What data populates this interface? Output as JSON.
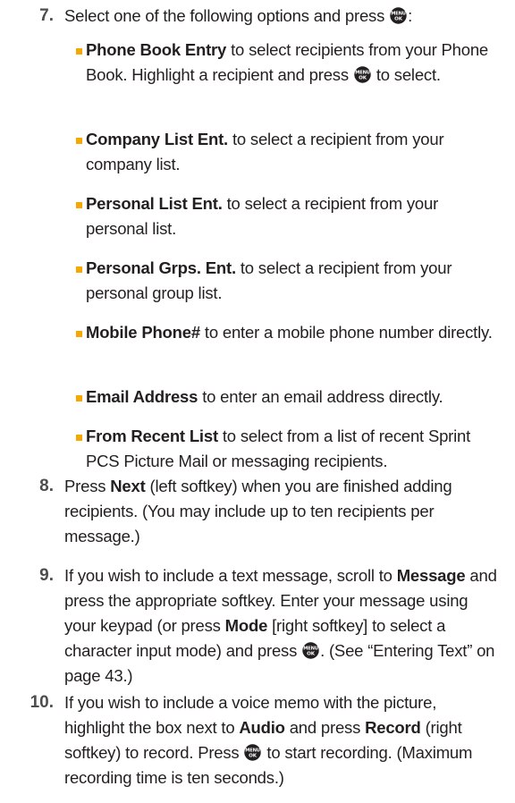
{
  "icons": {
    "menu_ok_key": "menu-ok-key-icon"
  },
  "colors": {
    "bullet": "#f6a800",
    "step_number": "#4d4d4f",
    "text": "#231f20"
  },
  "key_icon": {
    "top": "MENU",
    "bottom": "OK"
  },
  "step7": {
    "number": "7.",
    "text": "Select one of the following options and press",
    "text_end": ":",
    "options": [
      {
        "bold": "Phone Book Entry",
        "text": " to select recipients from your Phone Book. Highlight a recipient and press",
        "text2": " to select."
      },
      {
        "bold": "Company List Ent.",
        "text": " to select a recipient from your company list."
      },
      {
        "bold": "Personal List Ent.",
        "text": " to select a recipient from your personal list."
      },
      {
        "bold": "Personal Grps. Ent.",
        "text": " to select a recipient from your personal group list."
      },
      {
        "bold": "Mobile Phone#",
        "text": " to enter a mobile phone number directly."
      },
      {
        "bold": "Email Address",
        "text": " to enter an email address directly."
      },
      {
        "bold": "From Recent List",
        "text": " to select from a list of recent Sprint PCS Picture Mail or messaging recipients."
      }
    ]
  },
  "step8": {
    "number": "8.",
    "t1": "Press ",
    "b1": "Next",
    "t2": " (left softkey) when you are finished adding recipients. (You may include up to ten recipients per message.)"
  },
  "step9": {
    "number": "9.",
    "t1": "If you wish to include a text message, scroll to ",
    "b1": "Message",
    "t2": " and press the appropriate softkey. Enter your message using your keypad (or press ",
    "b2": "Mode",
    "t3": " [right softkey] to select a character input mode) and press",
    "t4": ". (See “Entering Text” on page 43.)"
  },
  "step10": {
    "number": "10.",
    "t1": "If you wish to include a voice memo with the picture, highlight the box next to ",
    "b1": "Audio",
    "t2": " and press ",
    "b2": "Record",
    "t3": " (right softkey) to record. Press",
    "t4": " to start recording. (Maximum recording time is ten seconds.)"
  }
}
